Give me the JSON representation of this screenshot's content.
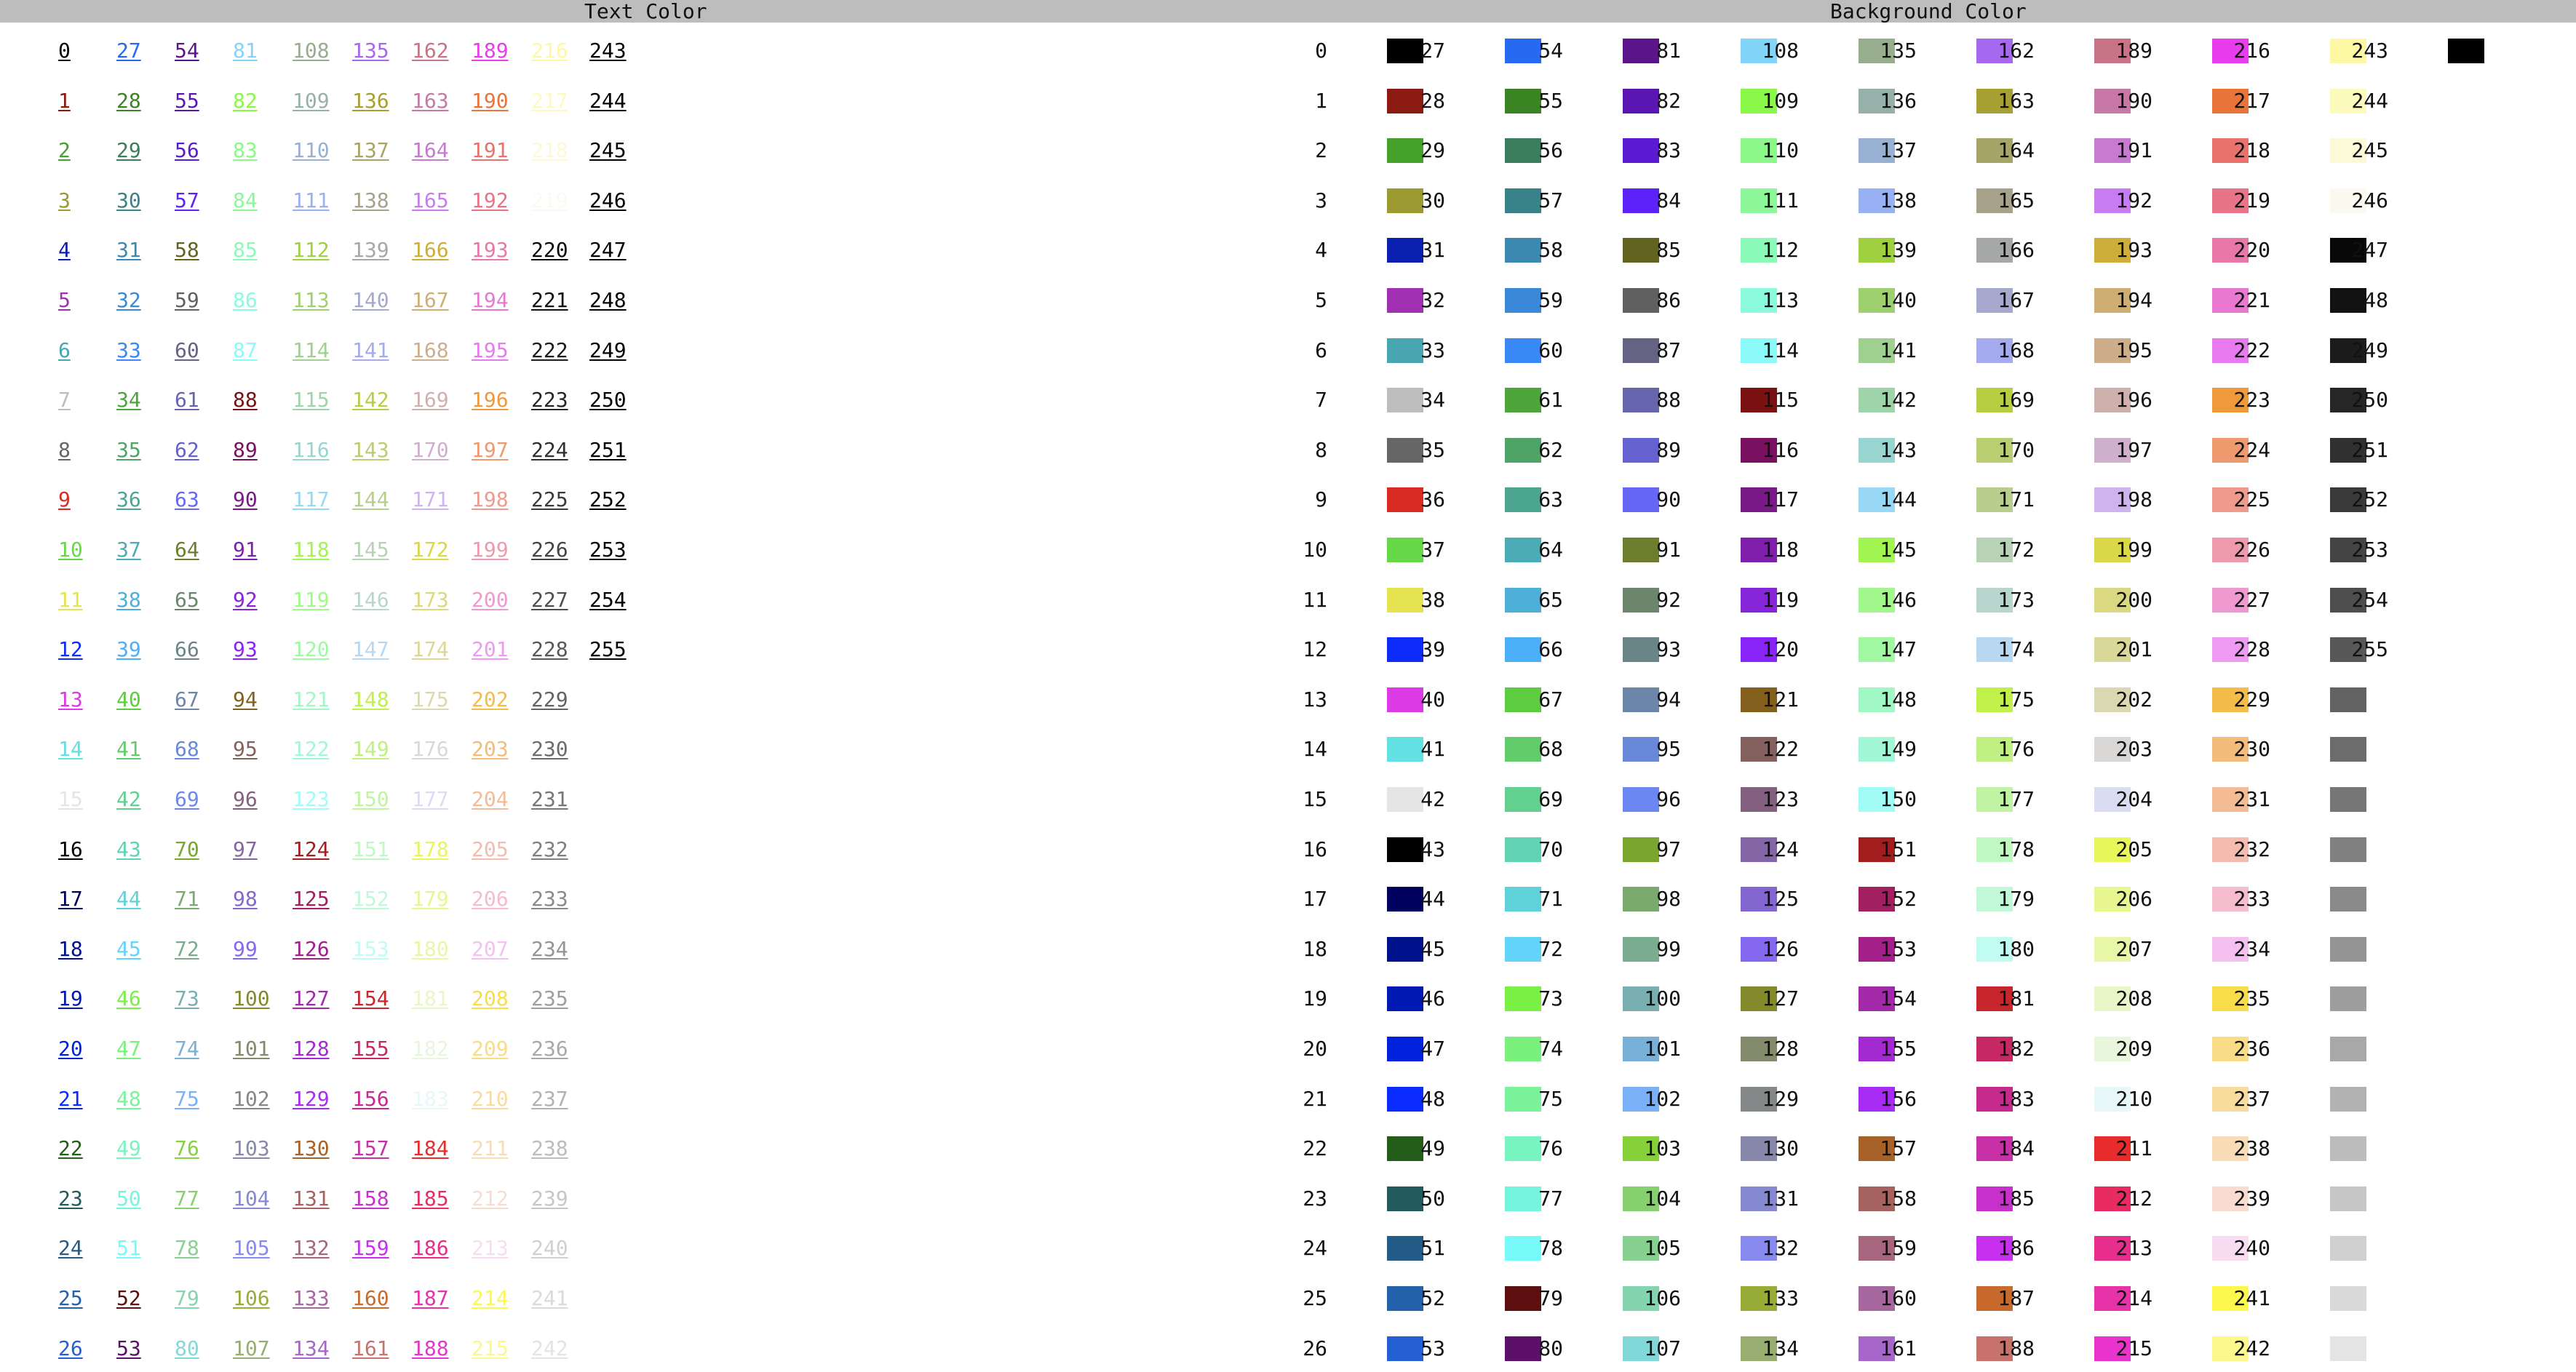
{
  "headers": {
    "text_color": "Text Color",
    "background_color": "Background Color"
  },
  "palette": [
    "#000000",
    "#8b1a12",
    "#46a12c",
    "#9a9a31",
    "#0b1fb0",
    "#a131b3",
    "#48a6b1",
    "#bdbdbd",
    "#666666",
    "#d92b22",
    "#67d949",
    "#e5e450",
    "#0f2bfa",
    "#dc3ae5",
    "#63e1e2",
    "#e5e5e5",
    "#000000",
    "#00005f",
    "#00118c",
    "#0019b3",
    "#0022dd",
    "#0a2cff",
    "#245c1a",
    "#235b5c",
    "#245c88",
    "#2361aa",
    "#2460d4",
    "#2769f0",
    "#3a8424",
    "#3a7e5e",
    "#38838a",
    "#3b88b0",
    "#3a88d8",
    "#3888f5",
    "#4ea53a",
    "#4ea467",
    "#4ca68f",
    "#4cacb5",
    "#4eb0d8",
    "#4cb0f8",
    "#5ecc40",
    "#63cc6a",
    "#62d08e",
    "#61d2b2",
    "#5fd2d9",
    "#62d4fa",
    "#7af044",
    "#7af17c",
    "#7af39b",
    "#77f4c0",
    "#76f5de",
    "#76fbf8",
    "#5c0f0e",
    "#5c106a",
    "#5c148a",
    "#5a16b2",
    "#5b1bd4",
    "#5c22f7",
    "#636320",
    "#606060",
    "#656383",
    "#6665ad",
    "#6661d1",
    "#6667f5",
    "#6c7e2c",
    "#6b866c",
    "#6a8588",
    "#6c86aa",
    "#6a88d8",
    "#6c86f2",
    "#7aa630",
    "#7aaa6e",
    "#7aac90",
    "#79afb0",
    "#78b0d8",
    "#79b0f6",
    "#86d13a",
    "#86d070",
    "#86d090",
    "#84d4b0",
    "#82d8d8",
    "#82d4f8",
    "#8af848",
    "#8cf88a",
    "#8cf89a",
    "#8cfab8",
    "#8cfadc",
    "#8cfaf8",
    "#7a1212",
    "#7a1060",
    "#7a1a88",
    "#7f1fac",
    "#8626d8",
    "#8924f8",
    "#84601f",
    "#84605e",
    "#846080",
    "#8465a6",
    "#8466d0",
    "#8468f0",
    "#848a2c",
    "#848a6c",
    "#848888",
    "#8888aa",
    "#8688d0",
    "#888af0",
    "#98ad38",
    "#98ad70",
    "#98ac8e",
    "#98b0aa",
    "#98b0d2",
    "#98b0f4",
    "#9fd040",
    "#9fd070",
    "#9fd090",
    "#9fd4aa",
    "#98d4d0",
    "#98d8f4",
    "#a2f450",
    "#a2f88c",
    "#a2f8a2",
    "#a2f8c4",
    "#a2f8d6",
    "#a2fcf6",
    "#a21e1e",
    "#a22060",
    "#a22088",
    "#a22aa8",
    "#a22ad0",
    "#a62cf4",
    "#a66228",
    "#a6625e",
    "#a6667e",
    "#a6669e",
    "#a666ca",
    "#a668ee",
    "#a6a032",
    "#a6a466",
    "#a6a28a",
    "#a6a8a8",
    "#a6a8ce",
    "#a6aaee",
    "#b8ce42",
    "#b8ce70",
    "#b8ce8e",
    "#b8d2b6",
    "#b8d6ce",
    "#b8d8f2",
    "#c0f04a",
    "#c0f082",
    "#c0f4a2",
    "#c0f8c2",
    "#c0f8d8",
    "#c0fcf2",
    "#c6262c",
    "#c62864",
    "#c62a8c",
    "#c830a8",
    "#c830cc",
    "#c830f0",
    "#c86a2c",
    "#c8726c",
    "#c87486",
    "#c878a6",
    "#c87ad0",
    "#c87cf2",
    "#ceae3a",
    "#ceae72",
    "#ceae8a",
    "#ceb0ac",
    "#ceb0cc",
    "#ceb4ec",
    "#dad848",
    "#dad880",
    "#dad898",
    "#dad8b0",
    "#dad8d6",
    "#dadcf2",
    "#e8f65a",
    "#e8f690",
    "#e8f6a8",
    "#e8f6c8",
    "#e8f6dc",
    "#e8f8f8",
    "#e82c2c",
    "#e82c62",
    "#e82e8c",
    "#e832aa",
    "#e834cc",
    "#e83cee",
    "#e8743a",
    "#e8726c",
    "#e87488",
    "#e878aa",
    "#e878d0",
    "#e87af0",
    "#ee9a3a",
    "#ee9a6e",
    "#ee9a8c",
    "#ee9aac",
    "#ee9ad0",
    "#ee9af2",
    "#f4bc48",
    "#f4bc7a",
    "#f4bc94",
    "#f4bcae",
    "#f4bccc",
    "#f4c0f0",
    "#f8dc4a",
    "#f8dc86",
    "#f8dc9e",
    "#f8dcb6",
    "#f8dcd0",
    "#f8dcf2",
    "#fcf84e",
    "#fcf88e",
    "#fcf8a4",
    "#fcfabc",
    "#fcfad6",
    "#fcfaf0",
    "#080808",
    "#121212",
    "#1c1c1c",
    "#262626",
    "#303030",
    "#3a3a3a",
    "#444444",
    "#4e4e4e",
    "#585858",
    "#626262",
    "#6c6c6c",
    "#767676",
    "#808080",
    "#8a8a8a",
    "#949494",
    "#9e9e9e",
    "#a8a8a8",
    "#b2b2b2",
    "#bcbcbc",
    "#c6c6c6",
    "#d0d0d0",
    "#dadada",
    "#e4e4e4",
    "#000000"
  ]
}
